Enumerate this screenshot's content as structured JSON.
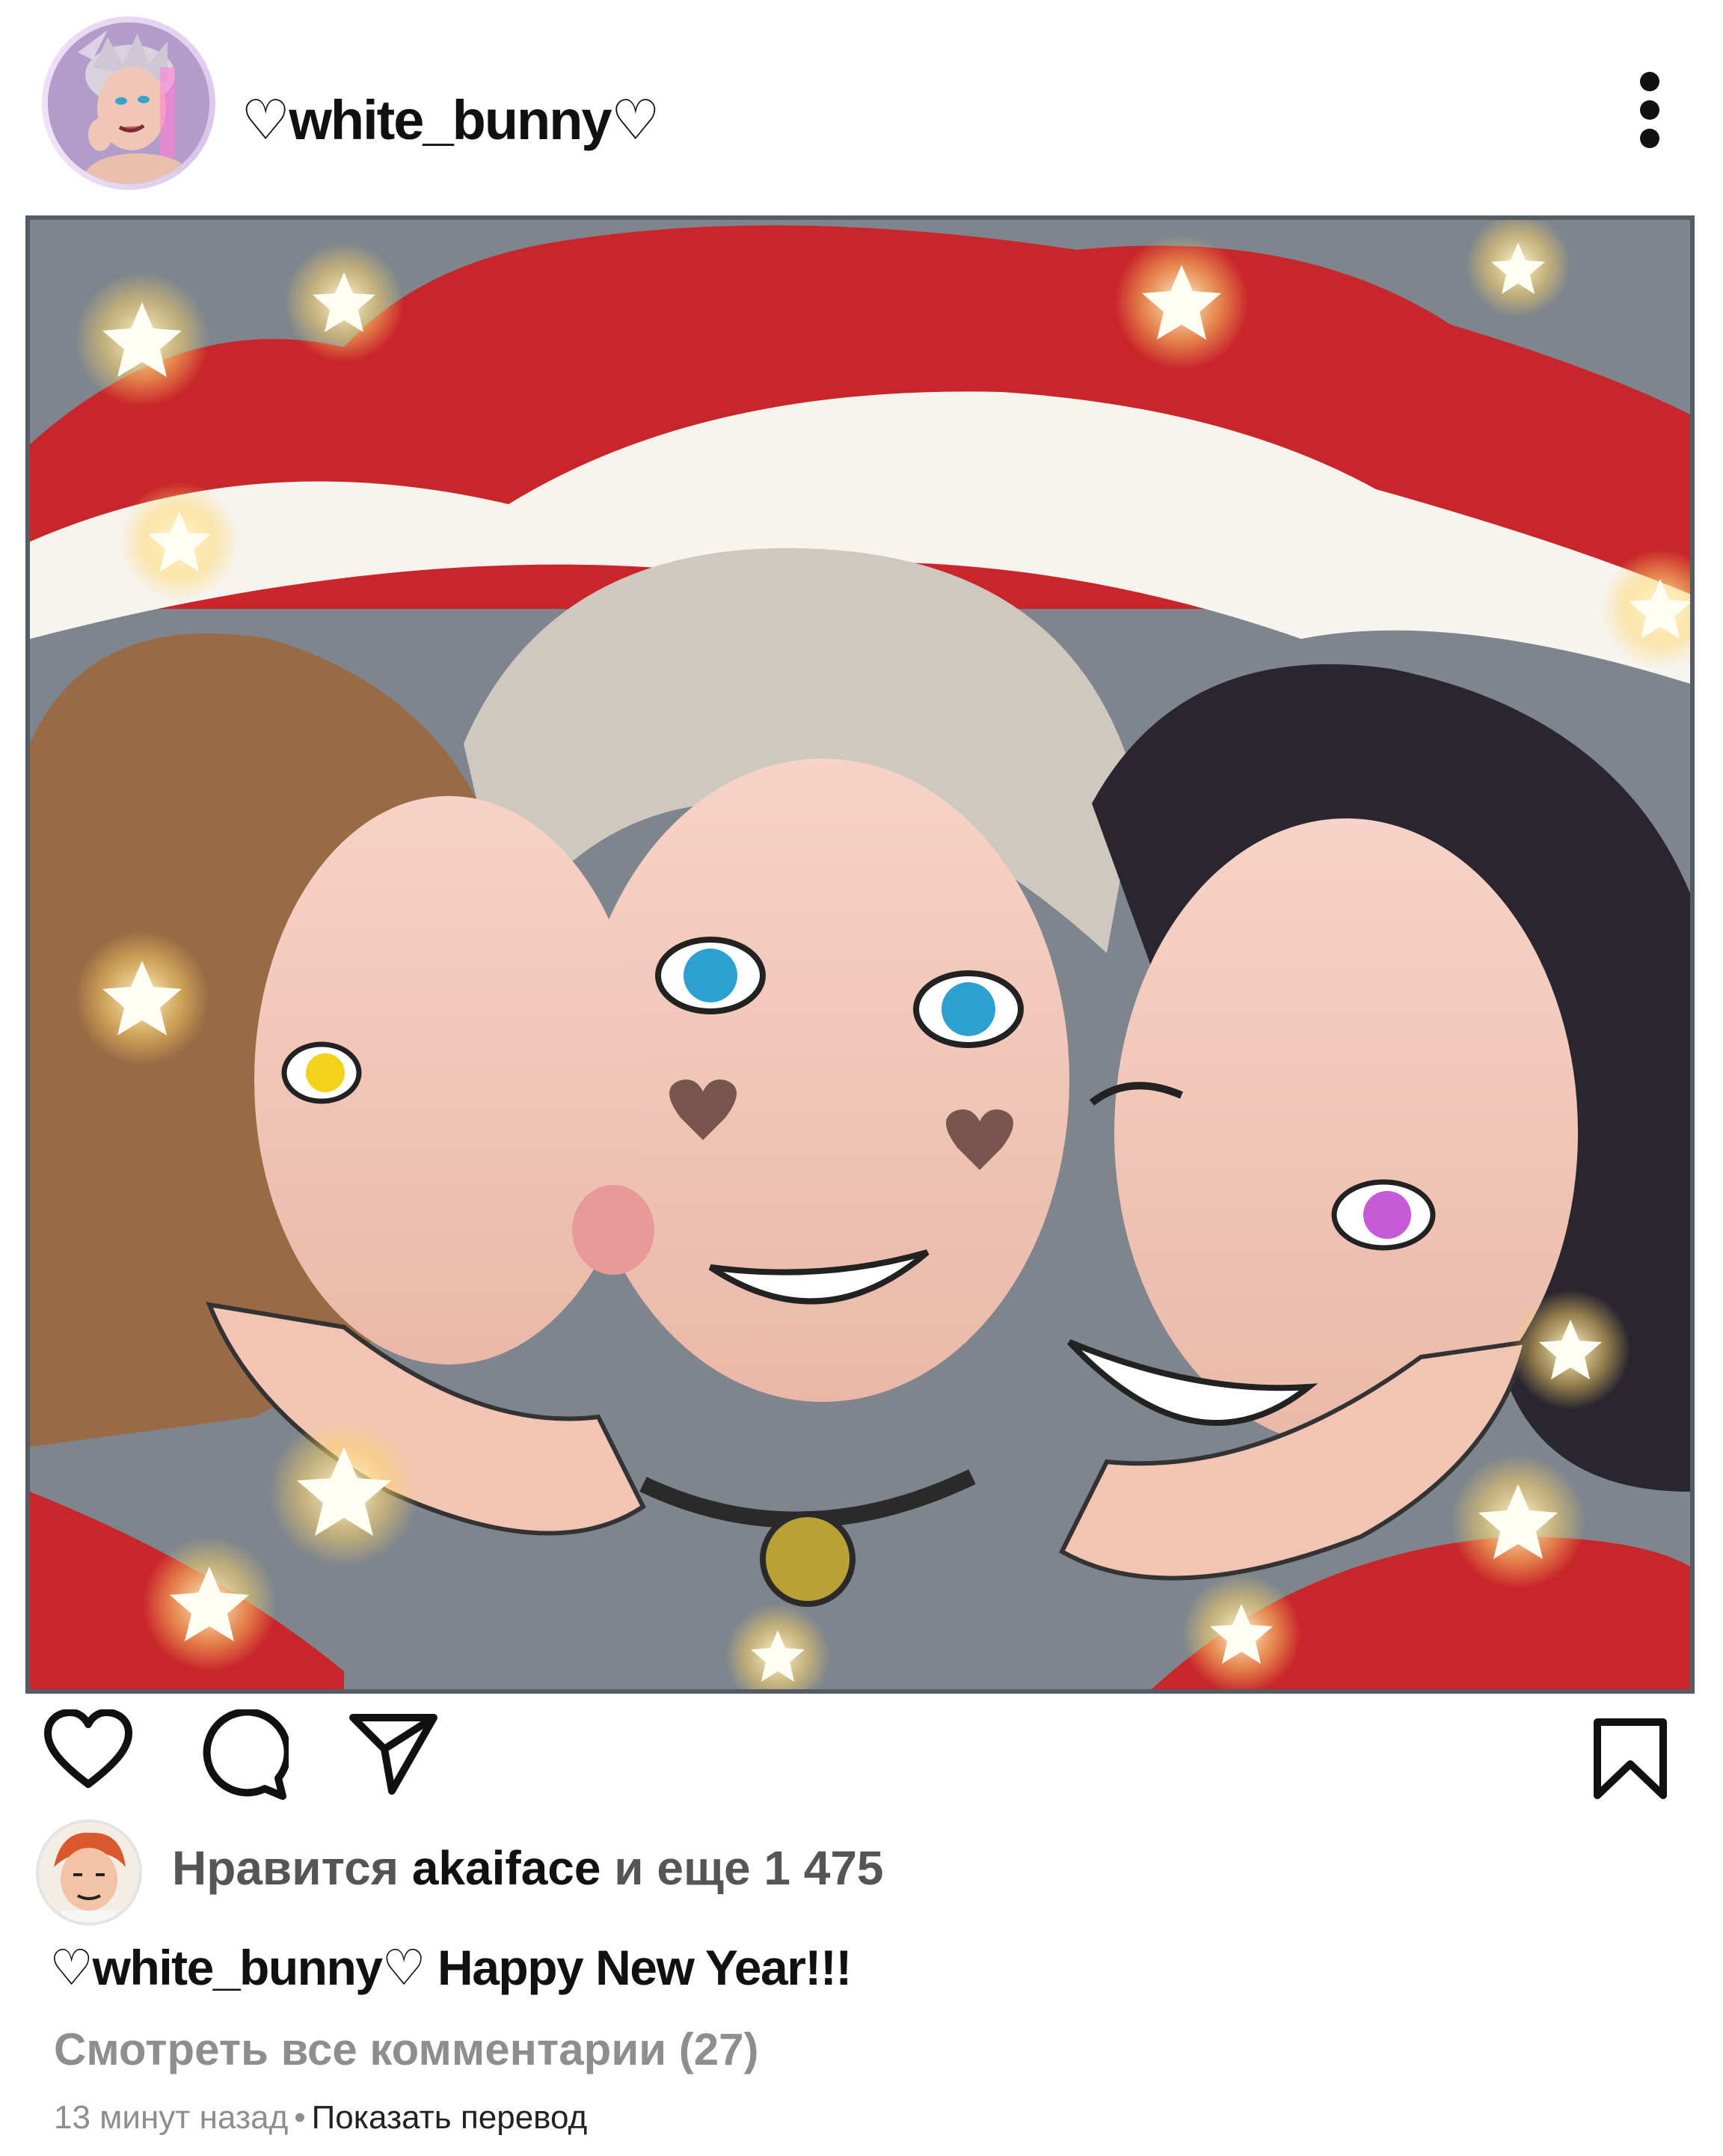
{
  "post": {
    "username": "♡white_bunny♡",
    "likes_prefix": "Нравится",
    "liker": "akaiface",
    "likes_suffix": "и еще 1 475",
    "caption_user": "♡white_bunny♡",
    "caption_text": "Happy New Year!!!",
    "view_comments": "Смотреть все комментарии (27)",
    "time_ago": "13 минут назад",
    "separator": "•",
    "translate": "Показать перевод"
  },
  "colors": {
    "background": "#ffffff",
    "text": "#111111",
    "muted": "#8e8e8e",
    "santa_red": "#c8262a",
    "fur_white": "#f7f3ee"
  },
  "icons": [
    "more-options-icon",
    "heart-icon",
    "comment-icon",
    "share-icon",
    "bookmark-icon"
  ]
}
